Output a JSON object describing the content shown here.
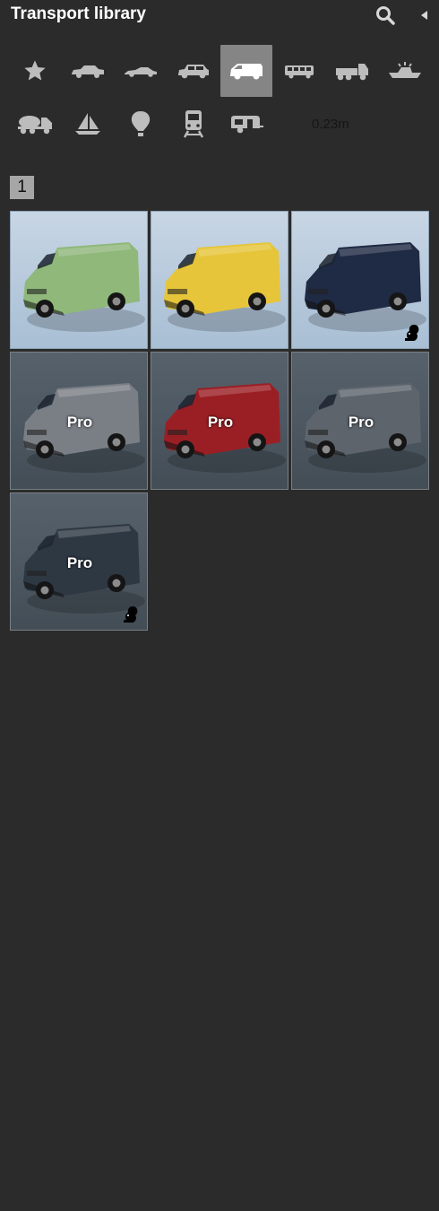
{
  "header": {
    "title": "Transport library",
    "search_icon": "search-icon",
    "collapse_icon": "collapse-arrow-icon"
  },
  "categories": [
    {
      "name": "favorites",
      "icon": "star-icon",
      "active": false
    },
    {
      "name": "sedan",
      "icon": "sedan-car-icon",
      "active": false
    },
    {
      "name": "sports-car",
      "icon": "sports-car-icon",
      "active": false
    },
    {
      "name": "suv",
      "icon": "suv-icon",
      "active": false
    },
    {
      "name": "van",
      "icon": "van-icon",
      "active": true
    },
    {
      "name": "bus",
      "icon": "bus-icon",
      "active": false
    },
    {
      "name": "truck",
      "icon": "truck-icon",
      "active": false
    },
    {
      "name": "boat",
      "icon": "boat-icon",
      "active": false
    },
    {
      "name": "construction",
      "icon": "cement-mixer-icon",
      "active": false
    },
    {
      "name": "sailboat",
      "icon": "sailboat-icon",
      "active": false
    },
    {
      "name": "balloon",
      "icon": "hot-air-balloon-icon",
      "active": false
    },
    {
      "name": "train",
      "icon": "train-icon",
      "active": false
    },
    {
      "name": "caravan",
      "icon": "caravan-icon",
      "active": false
    }
  ],
  "measure_text": "0.23m",
  "pagination": {
    "current_page": "1"
  },
  "items": [
    {
      "color": "#8fb87a",
      "pro": false,
      "pro_label": "",
      "squirrel": false
    },
    {
      "color": "#e6c53a",
      "pro": false,
      "pro_label": "",
      "squirrel": false
    },
    {
      "color": "#1f2a44",
      "pro": false,
      "pro_label": "",
      "squirrel": true
    },
    {
      "color": "#7a7f86",
      "pro": true,
      "pro_label": "Pro",
      "squirrel": false
    },
    {
      "color": "#9a1f25",
      "pro": true,
      "pro_label": "Pro",
      "squirrel": false
    },
    {
      "color": "#5d646c",
      "pro": true,
      "pro_label": "Pro",
      "squirrel": false
    },
    {
      "color": "#2e3843",
      "pro": true,
      "pro_label": "Pro",
      "squirrel": true
    }
  ],
  "colors": {
    "background": "#2b2b2b",
    "active_category": "#858585",
    "icon": "#bdbdbd",
    "page_badge": "#a6a6a6"
  }
}
